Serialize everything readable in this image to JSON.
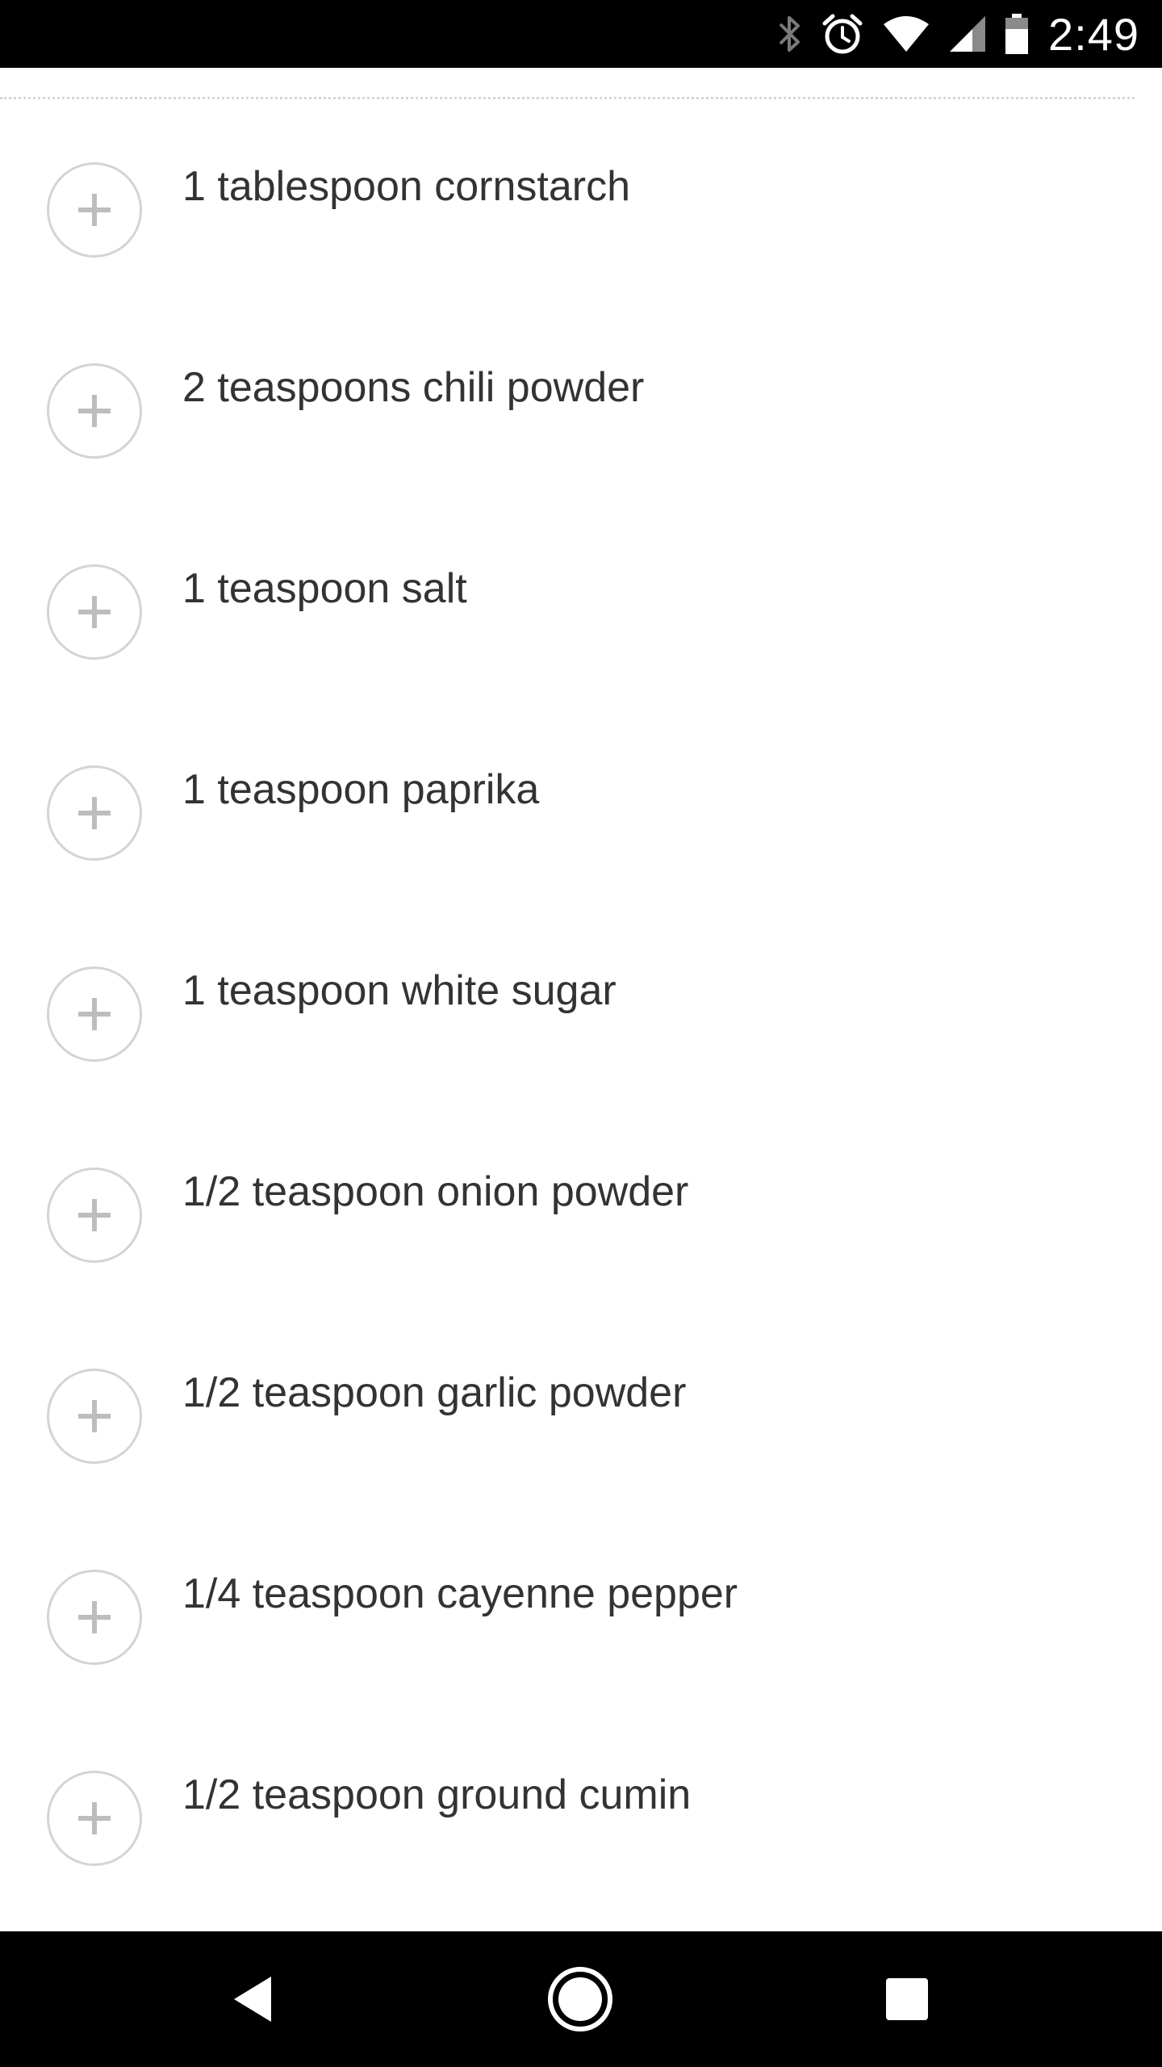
{
  "status_bar": {
    "time": "2:49",
    "icons": [
      "bluetooth-icon",
      "alarm-icon",
      "wifi-icon",
      "cell-signal-icon",
      "battery-icon"
    ]
  },
  "ingredients": [
    {
      "text": "1 tablespoon cornstarch"
    },
    {
      "text": "2 teaspoons chili powder"
    },
    {
      "text": "1 teaspoon salt"
    },
    {
      "text": "1 teaspoon paprika"
    },
    {
      "text": "1 teaspoon white sugar"
    },
    {
      "text": "1/2 teaspoon onion powder"
    },
    {
      "text": "1/2 teaspoon garlic powder"
    },
    {
      "text": "1/4 teaspoon cayenne pepper"
    },
    {
      "text": "1/2 teaspoon ground cumin"
    }
  ],
  "nav_bar": {
    "icons": [
      "back-icon",
      "home-icon",
      "recents-icon"
    ]
  }
}
